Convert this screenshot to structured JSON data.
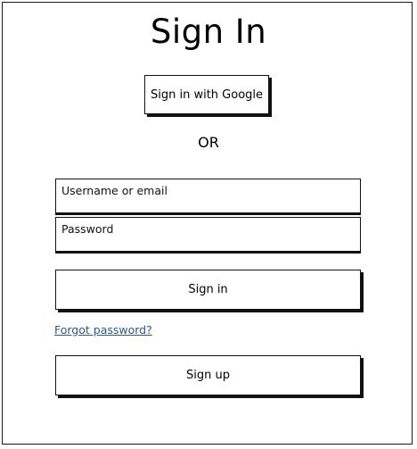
{
  "page": {
    "title": "Sign In"
  },
  "google_button": {
    "label": "Sign in with Google"
  },
  "separator": {
    "text": "OR"
  },
  "form": {
    "username_placeholder": "Username or email",
    "password_placeholder": "Password",
    "signin_label": "Sign in",
    "forgot_label": "Forgot password?",
    "signup_label": "Sign up"
  },
  "colors": {
    "border": "#111111",
    "link": "#1f5a9a",
    "background": "#ffffff"
  }
}
